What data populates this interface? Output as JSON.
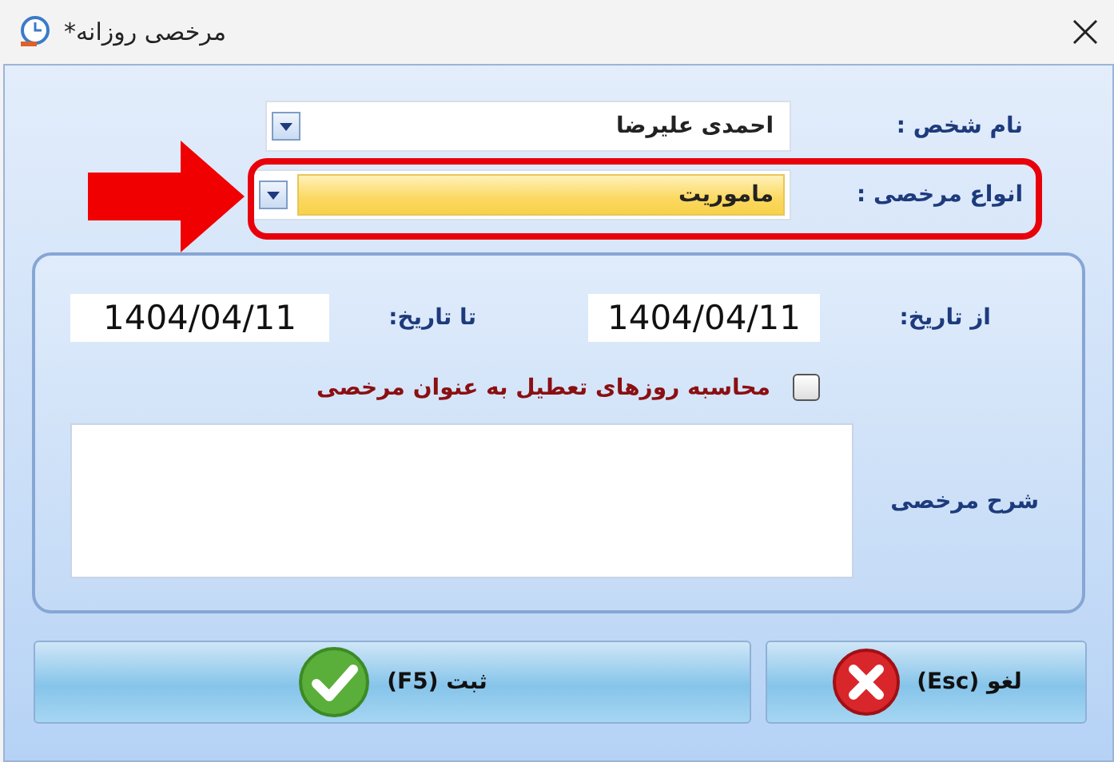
{
  "window": {
    "title": "مرخصی روزانه*"
  },
  "fields": [
    {
      "label": "نام شخص :",
      "value": "احمدی علیرضا",
      "highlighted": false
    },
    {
      "label": "انواع مرخصی :",
      "value": "ماموریت",
      "highlighted": true
    }
  ],
  "dates": [
    {
      "label": "از تاریخ:",
      "value": "1404/04/11"
    },
    {
      "label": "تا تاریخ:",
      "value": "1404/04/11"
    }
  ],
  "holiday_checkbox": {
    "label": "محاسبه روزهای تعطیل به عنوان مرخصی",
    "checked": false
  },
  "description": {
    "label": "شرح مرخصی"
  },
  "buttons": [
    {
      "kind": "cancel",
      "label": "لغو (Esc)"
    },
    {
      "kind": "submit",
      "label": "ثبت (F5)"
    }
  ]
}
